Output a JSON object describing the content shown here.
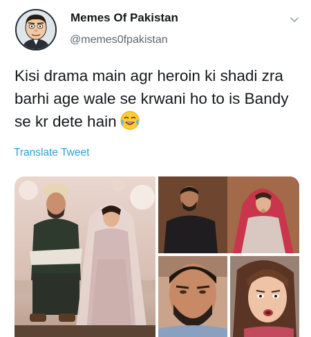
{
  "tweet": {
    "display_name": "Memes Of Pakistan",
    "handle": "@memes0fpakistan",
    "text": "Kisi drama main agr heroin ki shadi zra barhi age wale se krwani ho to is Bandy se kr dete hain",
    "emoji": "face-with-tears-of-joy-icon",
    "translate_label": "Translate Tweet"
  },
  "media": [
    {
      "description": "wedding-couple-photo"
    },
    {
      "description": "drama-scene-couple"
    },
    {
      "description": "man-closeup"
    },
    {
      "description": "woman-shocked-closeup"
    }
  ],
  "colors": {
    "link": "#2aa0d8",
    "handle": "#5b6670",
    "text": "#14171a"
  }
}
